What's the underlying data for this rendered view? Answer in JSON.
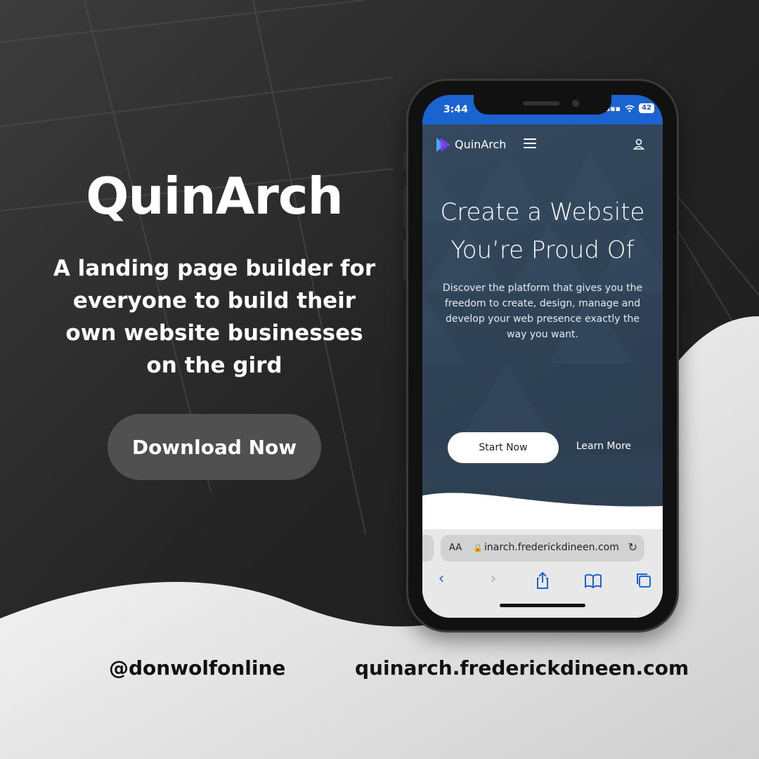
{
  "hero": {
    "title": "QuinArch",
    "tagline": "A landing page builder for everyone to build their own website businesses on the gird",
    "download_label": "Download Now"
  },
  "footer": {
    "handle": "@donwolfonline",
    "site": "quinarch.frederickdineen.com"
  },
  "phone": {
    "status": {
      "time": "3:44",
      "battery": "42"
    },
    "site": {
      "brand": "QuinArch",
      "headline_line1": "Create a Website",
      "headline_line2": "You’re Proud Of",
      "subtext": "Discover the platform that gives you the freedom to create, design, manage and develop your web presence exactly the way you want.",
      "start_label": "Start Now",
      "learn_label": "Learn More"
    },
    "browser": {
      "aa_label": "AA",
      "url": "inarch.frederickdineen.com"
    }
  },
  "colors": {
    "accent": "#1a63d0",
    "site_bg": "#2f4256",
    "button_dark": "#505050"
  }
}
